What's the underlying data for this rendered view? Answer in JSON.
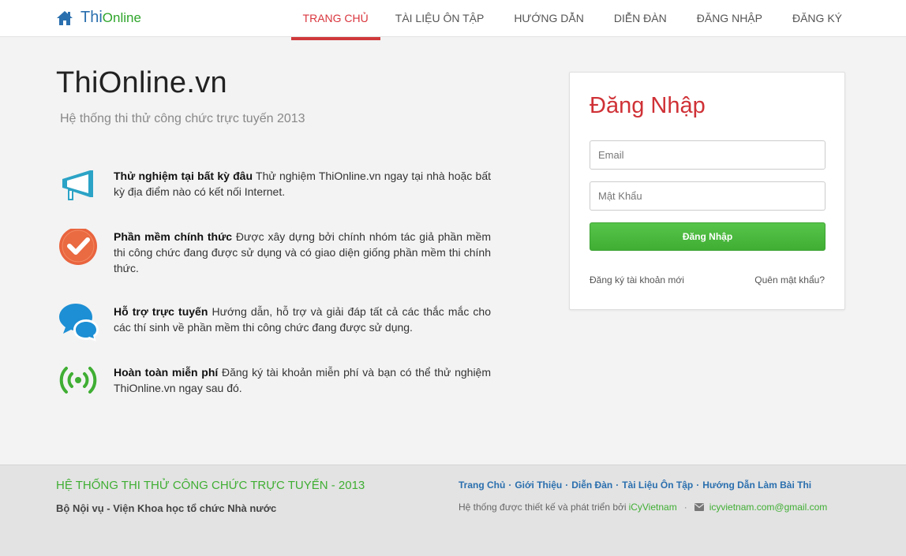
{
  "header": {
    "brand_part1": "Thi",
    "brand_part2": "Online",
    "nav": [
      {
        "label": "TRANG CHỦ",
        "active": true
      },
      {
        "label": "TÀI LIỆU ÔN TẬP"
      },
      {
        "label": "HƯỚNG DẪN"
      },
      {
        "label": "DIỄN ĐÀN"
      },
      {
        "label": "ĐĂNG NHẬP"
      },
      {
        "label": "ĐĂNG KÝ"
      }
    ]
  },
  "hero": {
    "title": "ThiOnline.vn",
    "tagline": "Hệ thống thi thử công chức trực tuyến 2013"
  },
  "features": [
    {
      "icon": "megaphone-icon",
      "title": "Thử nghiệm tại bất kỳ đâu",
      "text": "Thử nghiệm ThiOnline.vn ngay tại nhà hoặc bất kỳ địa điểm nào có kết nối Internet."
    },
    {
      "icon": "check-circle-icon",
      "title": "Phần mềm chính thức",
      "text": "Được xây dựng bởi chính nhóm tác giả phần mềm thi công chức đang được sử dụng và có giao diện giống phần mềm thi chính thức."
    },
    {
      "icon": "chat-bubbles-icon",
      "title": "Hỗ trợ trực tuyến",
      "text": "Hướng dẫn, hỗ trợ và giải đáp tất cả các thắc mắc cho các thí sinh về phần mềm thi công chức đang được sử dụng."
    },
    {
      "icon": "broadcast-icon",
      "title": "Hoàn toàn miễn phí",
      "text": "Đăng ký tài khoản miễn phí và bạn có thể thử nghiệm ThiOnline.vn ngay sau đó."
    }
  ],
  "login": {
    "title": "Đăng Nhập",
    "email_placeholder": "Email",
    "email_value": "",
    "password_placeholder": "Mật Khẩu",
    "password_value": "",
    "submit_label": "Đăng Nhập",
    "register_link": "Đăng ký tài khoản mới",
    "forgot_link": "Quên mật khẩu?"
  },
  "footer": {
    "title": "HỆ THỐNG THI THỬ CÔNG CHỨC TRỰC TUYẾN - 2013",
    "org": "Bộ Nội vụ - Viện Khoa học tổ chức Nhà nước",
    "links": [
      "Trang Chủ",
      "Giới Thiệu",
      "Diễn Đàn",
      "Tài Liệu Ôn Tập",
      "Hướng Dẫn Làm Bài Thi"
    ],
    "link_separator": "·",
    "credit_text": "Hệ thống được thiết kế và phát triển bởi",
    "credit_link": "iCyVietnam",
    "email": "icyvietnam.com@gmail.com"
  },
  "colors": {
    "brand_blue": "#2a6fae",
    "brand_green": "#3fae33",
    "accent_red": "#cf3136"
  }
}
